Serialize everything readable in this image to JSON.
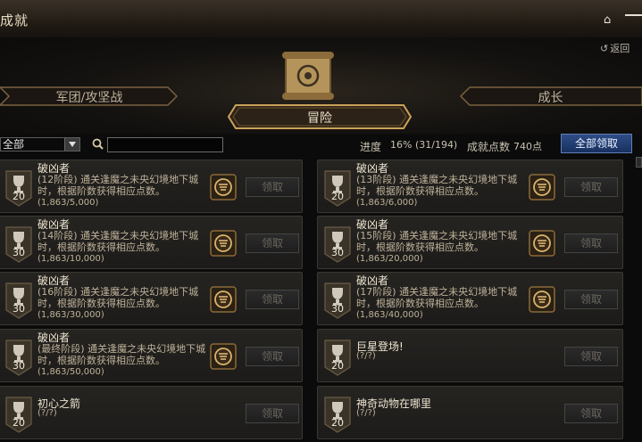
{
  "window": {
    "title": "成就",
    "back_label": "返回"
  },
  "tabs": {
    "left": "军团/攻坚战",
    "center": "冒险",
    "right": "成长"
  },
  "filter": {
    "selected": "全部",
    "search_placeholder": ""
  },
  "stats": {
    "progress_label": "进度",
    "progress_value": "16% (31/194)",
    "points_label": "成就点数",
    "points_value": "740点"
  },
  "claim_all_label": "全部领取",
  "claim_label": "领取",
  "cards": [
    {
      "name": "破凶者",
      "desc": "(12阶段) 通关逢魔之未央幻境地下城时，根据阶数获得相应点数。",
      "progress": "(1,863/5,000)",
      "points": "20"
    },
    {
      "name": "破凶者",
      "desc": "(13阶段) 通关逢魔之未央幻境地下城时，根据阶数获得相应点数。",
      "progress": "(1,863/6,000)",
      "points": "20"
    },
    {
      "name": "破凶者",
      "desc": "(14阶段) 通关逢魔之未央幻境地下城时，根据阶数获得相应点数。",
      "progress": "(1,863/10,000)",
      "points": "30"
    },
    {
      "name": "破凶者",
      "desc": "(15阶段) 通关逢魔之未央幻境地下城时，根据阶数获得相应点数。",
      "progress": "(1,863/20,000)",
      "points": "30"
    },
    {
      "name": "破凶者",
      "desc": "(16阶段) 通关逢魔之未央幻境地下城时，根据阶数获得相应点数。",
      "progress": "(1,863/30,000)",
      "points": "30"
    },
    {
      "name": "破凶者",
      "desc": "(17阶段) 通关逢魔之未央幻境地下城时，根据阶数获得相应点数。",
      "progress": "(1,863/40,000)",
      "points": "30"
    },
    {
      "name": "破凶者",
      "desc": "(最终阶段) 通关逢魔之未央幻境地下城时，根据阶数获得相应点数。",
      "progress": "(1,863/50,000)",
      "points": "30"
    },
    {
      "name": "巨星登场!",
      "desc": "",
      "progress": "(?/?)",
      "points": "20"
    },
    {
      "name": "初心之箭",
      "desc": "",
      "progress": "(?/?)",
      "points": "20"
    },
    {
      "name": "神奇动物在哪里",
      "desc": "",
      "progress": "(?/?)",
      "points": "20"
    }
  ],
  "colors": {
    "accent_blue": "#1f3f7a",
    "gold": "#c9a25a",
    "card_bg": "#232120"
  }
}
